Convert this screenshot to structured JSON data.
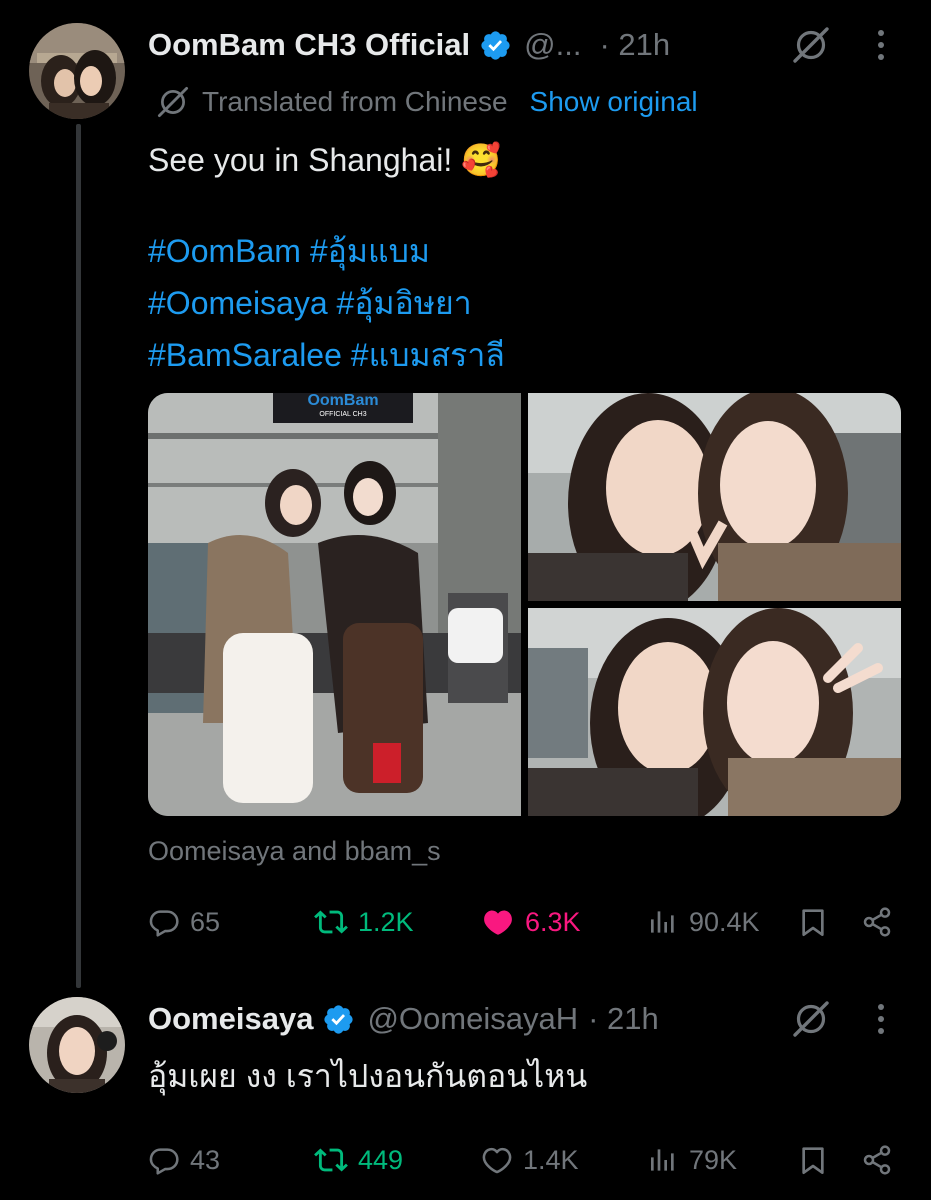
{
  "tweet": {
    "author_name": "OomBam CH3 Official",
    "author_handle": "@...",
    "time": "· 21h",
    "translation_note": "Translated from Chinese",
    "show_original": "Show original",
    "text": "See you in Shanghai! 🥰",
    "hashtags": [
      "#OomBam #อุ้มแบม",
      "#Oomeisaya #อุ้มอิษยา",
      "#BamSaralee #แบมสราลี"
    ],
    "photo_sign": "OomBam",
    "photo_sign_sub": "OFFICIAL CH3",
    "tagged": "Oomeisaya and bbam_s",
    "replies": "65",
    "reposts": "1.2K",
    "likes": "6.3K",
    "views": "90.4K",
    "reposted": true,
    "liked": true
  },
  "reply": {
    "author_name": "Oomeisaya",
    "author_handle": "@OomeisayaH",
    "time": "· 21h",
    "text": "อุ้มเผย งง เราไปงอนกันตอนไหน",
    "replies": "43",
    "reposts": "449",
    "likes": "1.4K",
    "views": "79K",
    "reposted": true,
    "liked": false
  },
  "icons": {
    "verified": "verified-badge-icon",
    "grok": "grok-icon",
    "more": "more-options-icon",
    "reply": "reply-icon",
    "repost": "repost-icon",
    "like": "like-icon",
    "views": "views-icon",
    "bookmark": "bookmark-icon",
    "share": "share-icon"
  },
  "colors": {
    "background": "#000000",
    "primary_text": "#e7e9ea",
    "secondary_text": "#71767b",
    "link": "#1d9bf0",
    "repost_active": "#00ba7c",
    "like_active": "#f91880"
  }
}
